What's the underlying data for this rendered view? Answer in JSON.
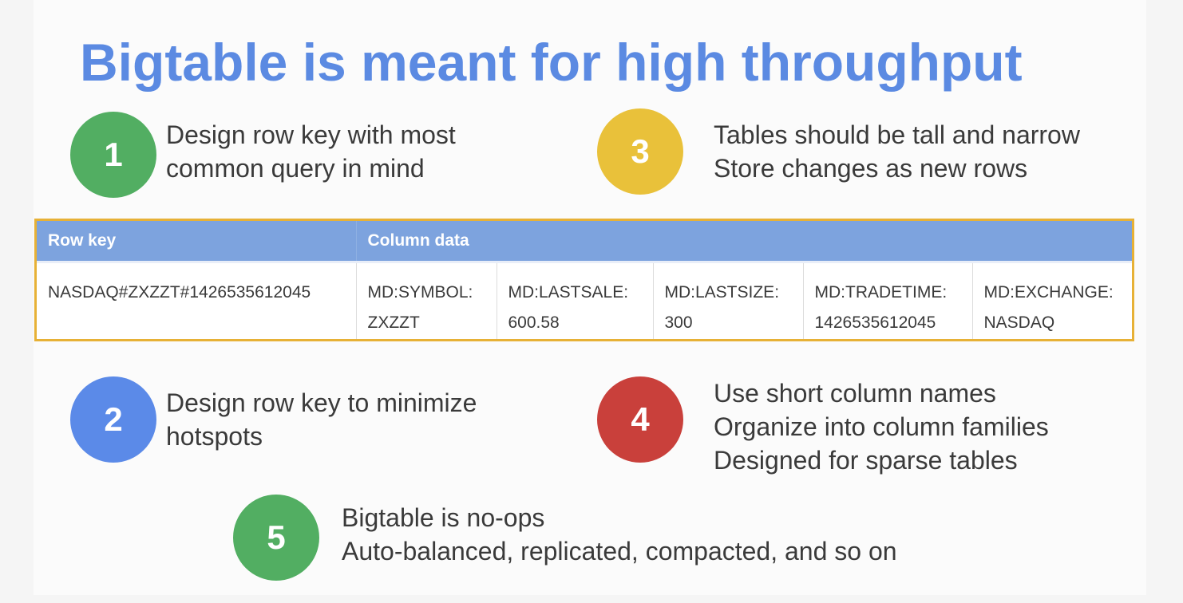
{
  "title": "Bigtable is meant for high throughput",
  "points": [
    {
      "number": "1",
      "color": "#52ae62",
      "lines": [
        "Design row key with most",
        "common query in mind"
      ]
    },
    {
      "number": "2",
      "color": "#5b8ae8",
      "lines": [
        "Design row key to minimize",
        "hotspots"
      ]
    },
    {
      "number": "3",
      "color": "#e9c13a",
      "lines": [
        "Tables should be tall and narrow",
        "Store changes as new rows"
      ]
    },
    {
      "number": "4",
      "color": "#c9403b",
      "lines": [
        "Use short column names",
        "Organize into column families",
        "Designed for sparse tables"
      ]
    },
    {
      "number": "5",
      "color": "#52ae62",
      "lines": [
        "Bigtable is no-ops",
        "Auto-balanced, replicated, compacted, and so on"
      ]
    }
  ],
  "table": {
    "headers": {
      "row_key": "Row key",
      "column_data": "Column data"
    },
    "row": {
      "key": "NASDAQ#ZXZZT#1426535612045",
      "cells": [
        {
          "name": "MD:SYMBOL:",
          "value": "ZXZZT"
        },
        {
          "name": "MD:LASTSALE:",
          "value": "600.58"
        },
        {
          "name": "MD:LASTSIZE:",
          "value": "300"
        },
        {
          "name": "MD:TRADETIME:",
          "value": "1426535612045"
        },
        {
          "name": "MD:EXCHANGE:",
          "value": "NASDAQ"
        }
      ]
    }
  }
}
